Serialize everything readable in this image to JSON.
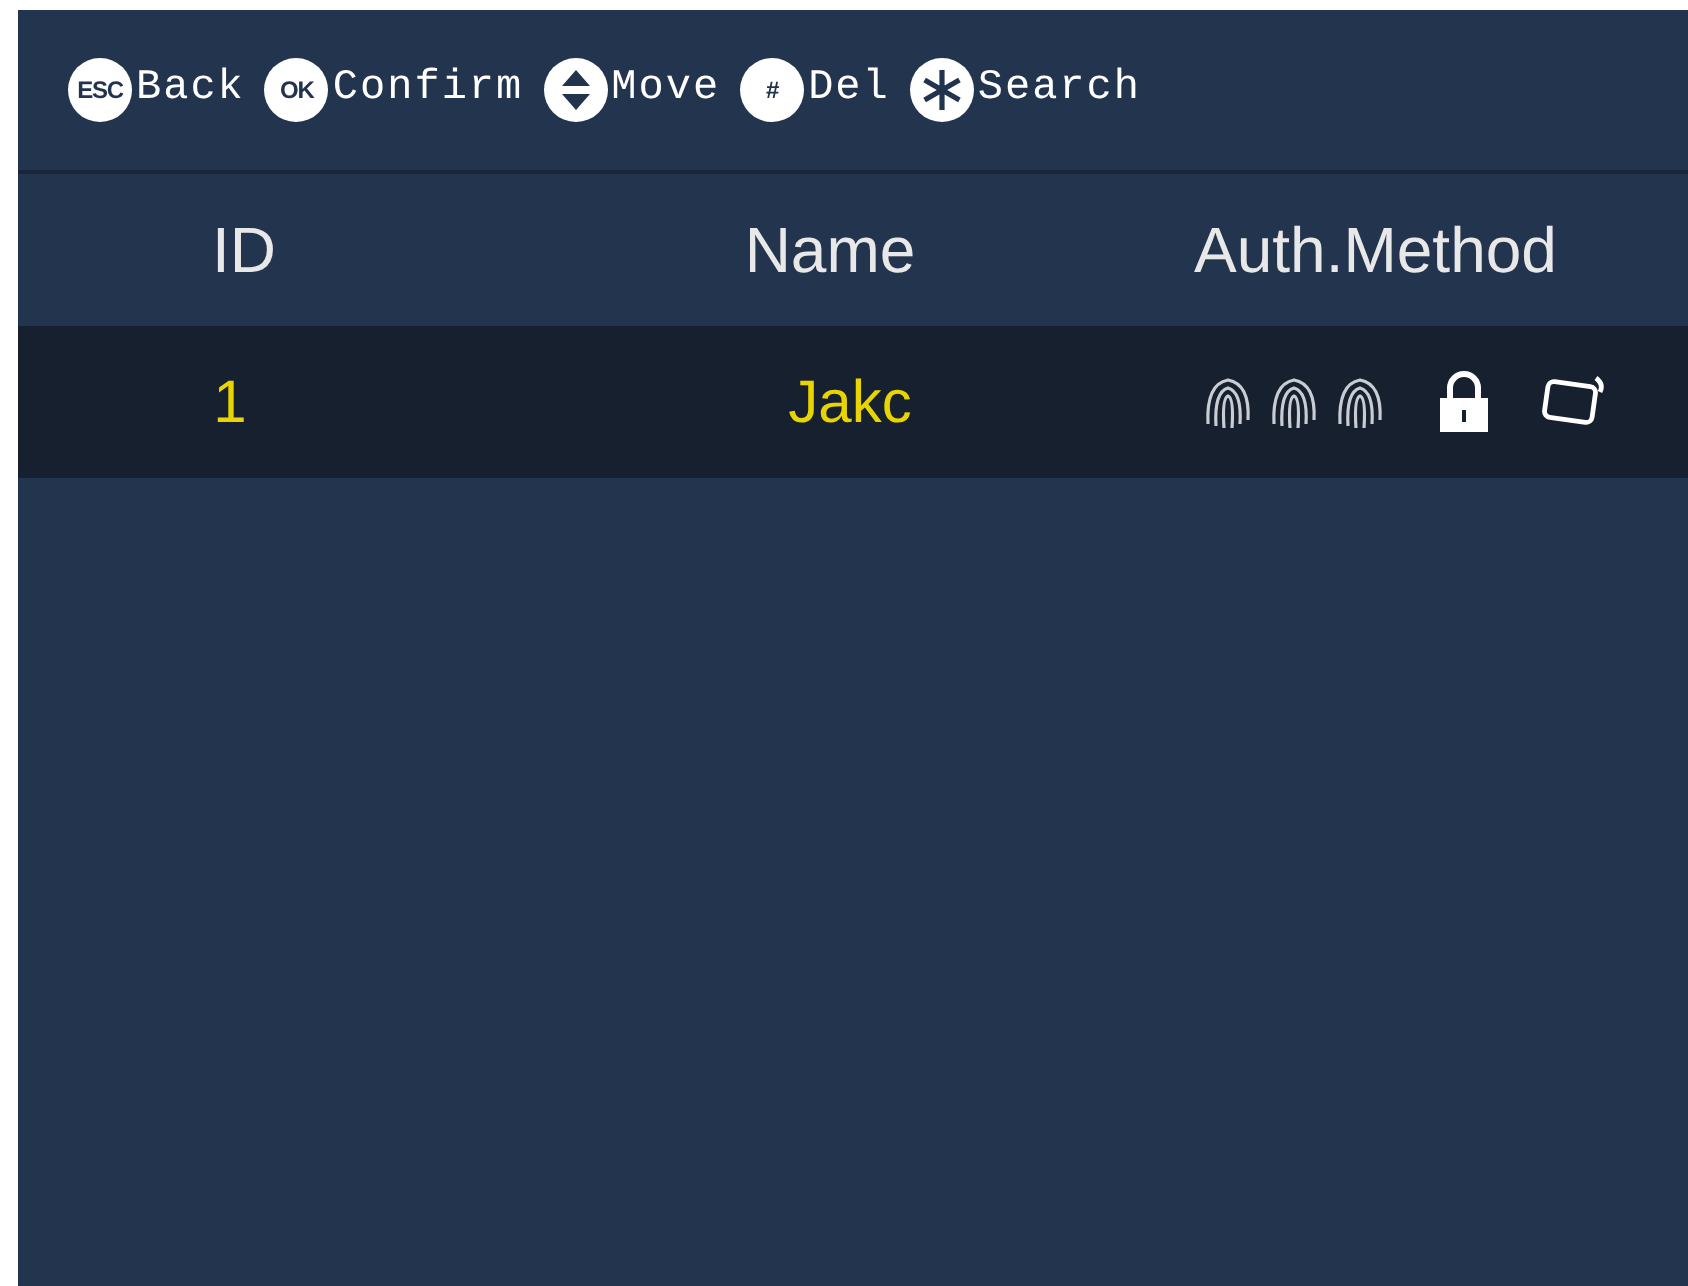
{
  "hints": [
    {
      "kind": "text",
      "key": "ESC",
      "label": "Back"
    },
    {
      "kind": "text",
      "key": "OK",
      "label": "Confirm"
    },
    {
      "kind": "move",
      "label": "Move"
    },
    {
      "kind": "text",
      "key": "#",
      "label": "Del"
    },
    {
      "kind": "search",
      "label": "Search"
    }
  ],
  "table": {
    "columns": [
      "ID",
      "Name",
      "Auth.Method"
    ],
    "rows": [
      {
        "selected": true,
        "id": "1",
        "name": "Jakc",
        "methods": [
          {
            "kind": "fingerprint"
          },
          {
            "kind": "fingerprint"
          },
          {
            "kind": "fingerprint"
          },
          {
            "kind": "password"
          },
          {
            "kind": "card"
          }
        ]
      }
    ]
  }
}
